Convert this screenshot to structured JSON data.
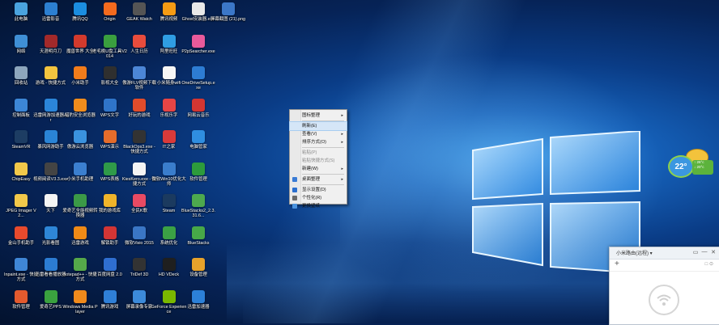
{
  "desktop": {
    "icons": [
      {
        "label": "此电脑",
        "name": "this-pc",
        "color": "#4aa3df",
        "col": 0,
        "row": 0
      },
      {
        "label": "迅雷影音",
        "name": "xunlei-player",
        "color": "#2c7fd1",
        "col": 1,
        "row": 0
      },
      {
        "label": "腾讯QQ",
        "name": "tencent-qq",
        "color": "#1b8de0",
        "col": 2,
        "row": 0
      },
      {
        "label": "Origin",
        "name": "origin",
        "color": "#f46a1e",
        "col": 3,
        "row": 0
      },
      {
        "label": "GEAK Watch",
        "name": "geak-watch",
        "color": "#555555",
        "col": 4,
        "row": 0
      },
      {
        "label": "腾讯视频",
        "name": "tencent-video",
        "color": "#f59b14",
        "col": 5,
        "row": 0
      },
      {
        "label": "Ghost安装器.exe",
        "name": "ghost-installer",
        "color": "#e9e9e9",
        "col": 6,
        "row": 0
      },
      {
        "label": "屏幕截图 (21).png",
        "name": "screenshot-png",
        "color": "#3b77c8",
        "col": 7,
        "row": 0
      },
      {
        "label": "网络",
        "name": "network",
        "color": "#3f8fd6",
        "col": 0,
        "row": 1
      },
      {
        "label": "天涯明月刀",
        "name": "tianya",
        "color": "#a2292a",
        "col": 1,
        "row": 1
      },
      {
        "label": "魔兽世界 大全",
        "name": "wow-box",
        "color": "#d33a2d",
        "col": 2,
        "row": 1
      },
      {
        "label": "老毛桃U盘工具V2014",
        "name": "laomaotao",
        "color": "#3a9f3f",
        "col": 3,
        "row": 1
      },
      {
        "label": "人生日历",
        "name": "life-calendar",
        "color": "#e84c3d",
        "col": 4,
        "row": 1
      },
      {
        "label": "阿里旺旺",
        "name": "aliwangwang",
        "color": "#2f9de3",
        "col": 5,
        "row": 1
      },
      {
        "label": "P2pSearcher.exe",
        "name": "p2psearcher",
        "color": "#e85a9b",
        "col": 6,
        "row": 1
      },
      {
        "label": "回收站",
        "name": "recycle-bin",
        "color": "#8da6bd",
        "col": 0,
        "row": 2
      },
      {
        "label": "游戏 - 快捷方式",
        "name": "games-shortcut",
        "color": "#f3c43f",
        "col": 1,
        "row": 2
      },
      {
        "label": "小米助手",
        "name": "mi-assistant",
        "color": "#f27c1b",
        "col": 2,
        "row": 2
      },
      {
        "label": "影视大全",
        "name": "video-all",
        "color": "#2f2f2f",
        "col": 3,
        "row": 2
      },
      {
        "label": "傲游FLV视频下载软件",
        "name": "maxthon-flv",
        "color": "#4c86d6",
        "col": 4,
        "row": 2
      },
      {
        "label": "小米随身wifi",
        "name": "mi-wifi",
        "color": "#f6f6f6",
        "col": 5,
        "row": 2
      },
      {
        "label": "OneDriveSetup.exe",
        "name": "onedrive-setup",
        "color": "#2d7cd3",
        "col": 6,
        "row": 2
      },
      {
        "label": "控制面板",
        "name": "control-panel",
        "color": "#3c86d6",
        "col": 0,
        "row": 3
      },
      {
        "label": "迅雷网游加速器Air",
        "name": "xunlei-air",
        "color": "#2b85d9",
        "col": 1,
        "row": 3
      },
      {
        "label": "猎豹安全浏览器",
        "name": "liebao-browser",
        "color": "#f08c1c",
        "col": 2,
        "row": 3
      },
      {
        "label": "WPS文字",
        "name": "wps-writer",
        "color": "#2f74c9",
        "col": 3,
        "row": 3
      },
      {
        "label": "好玩的游戏",
        "name": "fun-games",
        "color": "#e04c2b",
        "col": 4,
        "row": 3
      },
      {
        "label": "乐视乐字",
        "name": "letv",
        "color": "#e64545",
        "col": 5,
        "row": 3
      },
      {
        "label": "网易云音乐",
        "name": "netease-music",
        "color": "#d33632",
        "col": 6,
        "row": 3
      },
      {
        "label": "SteamVR",
        "name": "steamvr",
        "color": "#1d3d63",
        "col": 0,
        "row": 4
      },
      {
        "label": "暴风网游助手",
        "name": "baofeng-assist",
        "color": "#2a84d6",
        "col": 1,
        "row": 4
      },
      {
        "label": "傲游云浏览器",
        "name": "maxthon-cloud",
        "color": "#3a92de",
        "col": 2,
        "row": 4
      },
      {
        "label": "WPS演示",
        "name": "wps-present",
        "color": "#e46c2b",
        "col": 3,
        "row": 4
      },
      {
        "label": "BlackOps3.exe - 快捷方式",
        "name": "blackops3",
        "color": "#333333",
        "col": 4,
        "row": 4
      },
      {
        "label": "IT之家",
        "name": "ithome",
        "color": "#d93a3a",
        "col": 5,
        "row": 4
      },
      {
        "label": "电脑管家",
        "name": "pc-manager",
        "color": "#2f8ee0",
        "col": 6,
        "row": 4
      },
      {
        "label": "ChipEasy",
        "name": "chipeasy",
        "color": "#f2c84a",
        "col": 0,
        "row": 5
      },
      {
        "label": "视频阅读V3.3.exe",
        "name": "video-reader",
        "color": "#444444",
        "col": 1,
        "row": 5
      },
      {
        "label": "小米手机助理",
        "name": "mi-phone",
        "color": "#3b7fd0",
        "col": 2,
        "row": 5
      },
      {
        "label": "WPS表格",
        "name": "wps-sheet",
        "color": "#2f9a49",
        "col": 3,
        "row": 5
      },
      {
        "label": "KiesKero.exe - 快捷方式",
        "name": "kies",
        "color": "#f4f4f4",
        "col": 4,
        "row": 5
      },
      {
        "label": "微软Win10优化大师",
        "name": "win10-master",
        "color": "#3a7dcc",
        "col": 5,
        "row": 5
      },
      {
        "label": "软件管理",
        "name": "software-manager",
        "color": "#2d9b3c",
        "col": 6,
        "row": 5
      },
      {
        "label": "JPEG Imager V2...",
        "name": "jpeg-imager",
        "color": "#f2c84a",
        "col": 0,
        "row": 6
      },
      {
        "label": "天下",
        "name": "tianxia",
        "color": "#f4f4f4",
        "col": 1,
        "row": 6
      },
      {
        "label": "爱奇艺全能视频转换器",
        "name": "iqiyi-converter",
        "color": "#3b9a47",
        "col": 2,
        "row": 6
      },
      {
        "label": "我的游戏库",
        "name": "my-games",
        "color": "#f0b42a",
        "col": 3,
        "row": 6
      },
      {
        "label": "全民K歌",
        "name": "quanmin-k",
        "color": "#e84a63",
        "col": 4,
        "row": 6
      },
      {
        "label": "Steam",
        "name": "steam",
        "color": "#1b3a5f",
        "col": 5,
        "row": 6
      },
      {
        "label": "BlueStacks2_2.3.31.6...",
        "name": "bluestacks2",
        "color": "#4da94e",
        "col": 6,
        "row": 6
      },
      {
        "label": "金山手机助手",
        "name": "kingsoft-phone",
        "color": "#e84a2d",
        "col": 0,
        "row": 7
      },
      {
        "label": "光影看图",
        "name": "guangying",
        "color": "#2e86d7",
        "col": 1,
        "row": 7
      },
      {
        "label": "迅雷游戏",
        "name": "xunlei-game",
        "color": "#ef8a17",
        "col": 2,
        "row": 7
      },
      {
        "label": "解锁助手",
        "name": "unlock-assist",
        "color": "#d23535",
        "col": 3,
        "row": 7
      },
      {
        "label": "微软Visio 2015",
        "name": "visio-2015",
        "color": "#3a76c5",
        "col": 4,
        "row": 7
      },
      {
        "label": "系统优化",
        "name": "sys-optimize",
        "color": "#3ba145",
        "col": 5,
        "row": 7
      },
      {
        "label": "BlueStacks",
        "name": "bluestacks",
        "color": "#47a848",
        "col": 6,
        "row": 7
      },
      {
        "label": "Inpaint.exe - 快捷方式",
        "name": "inpaint",
        "color": "#3f86d6",
        "col": 0,
        "row": 8
      },
      {
        "label": "迅雷看看播放器",
        "name": "xunlei-kankan",
        "color": "#2c7cd2",
        "col": 1,
        "row": 8
      },
      {
        "label": "notepad++ - 快捷方式",
        "name": "notepadpp",
        "color": "#55a84a",
        "col": 2,
        "row": 8
      },
      {
        "label": "百度网盘 2.0",
        "name": "baidu-pan",
        "color": "#2f6ed0",
        "col": 3,
        "row": 8
      },
      {
        "label": "TriDef 3D",
        "name": "tridef",
        "color": "#333333",
        "col": 4,
        "row": 8
      },
      {
        "label": "HD VDeck",
        "name": "hd-vdeck",
        "color": "#1f1f1f",
        "col": 5,
        "row": 8
      },
      {
        "label": "设备管理",
        "name": "device-manager",
        "color": "#e7a22b",
        "col": 6,
        "row": 8
      },
      {
        "label": "软件管理",
        "name": "software-manager-2",
        "color": "#e35a2e",
        "col": 0,
        "row": 9
      },
      {
        "label": "爱奇艺PPS",
        "name": "iqiyi-pps",
        "color": "#3aa13f",
        "col": 1,
        "row": 9
      },
      {
        "label": "Windows Media Player",
        "name": "wmp",
        "color": "#f08a1c",
        "col": 2,
        "row": 9
      },
      {
        "label": "腾讯游戏",
        "name": "tencent-games",
        "color": "#2f7fd7",
        "col": 3,
        "row": 9
      },
      {
        "label": "屏幕录像专家",
        "name": "screen-recorder",
        "color": "#3c8ad9",
        "col": 4,
        "row": 9
      },
      {
        "label": "GeForce Experience",
        "name": "geforce",
        "color": "#7ab800",
        "col": 5,
        "row": 9
      },
      {
        "label": "迅雷加速器",
        "name": "xunlei-accel",
        "color": "#2c80d8",
        "col": 6,
        "row": 9
      }
    ]
  },
  "context_menu": {
    "items": [
      {
        "label": "图标整理",
        "arrow": "▸",
        "type": "item"
      },
      {
        "type": "sep"
      },
      {
        "label": "刷新(E)",
        "arrow": "",
        "type": "item",
        "highlight": true
      },
      {
        "label": "查看(V)",
        "arrow": "▸",
        "type": "item"
      },
      {
        "label": "排序方式(O)",
        "arrow": "▸",
        "type": "item"
      },
      {
        "type": "sep"
      },
      {
        "label": "粘贴(P)",
        "arrow": "",
        "type": "item",
        "disabled": true
      },
      {
        "label": "粘贴快捷方式(S)",
        "arrow": "",
        "type": "item",
        "disabled": true
      },
      {
        "label": "新建(W)",
        "arrow": "▸",
        "type": "item"
      },
      {
        "type": "sep"
      },
      {
        "label": "桌面整理",
        "arrow": "▸",
        "type": "item",
        "icon": "#3a7bd5"
      },
      {
        "type": "sep"
      },
      {
        "label": "显示设置(D)",
        "arrow": "",
        "type": "item",
        "icon": "#2b6fcf"
      },
      {
        "label": "个性化(R)",
        "arrow": "",
        "type": "item",
        "icon": "#6b6b6b"
      },
      {
        "label": "更换壁纸",
        "arrow": "",
        "type": "item",
        "icon": "#4a92de"
      }
    ]
  },
  "weather": {
    "temperature": "22°",
    "line1": "↑ 26°c",
    "line2": "↓ 20°c"
  },
  "router_panel": {
    "title": "小米路由(远程)",
    "title_arrow": "▾",
    "plus": "+",
    "buttons": [
      "▭",
      "—",
      "✕"
    ],
    "toolbar_right": "□ ⊙"
  }
}
